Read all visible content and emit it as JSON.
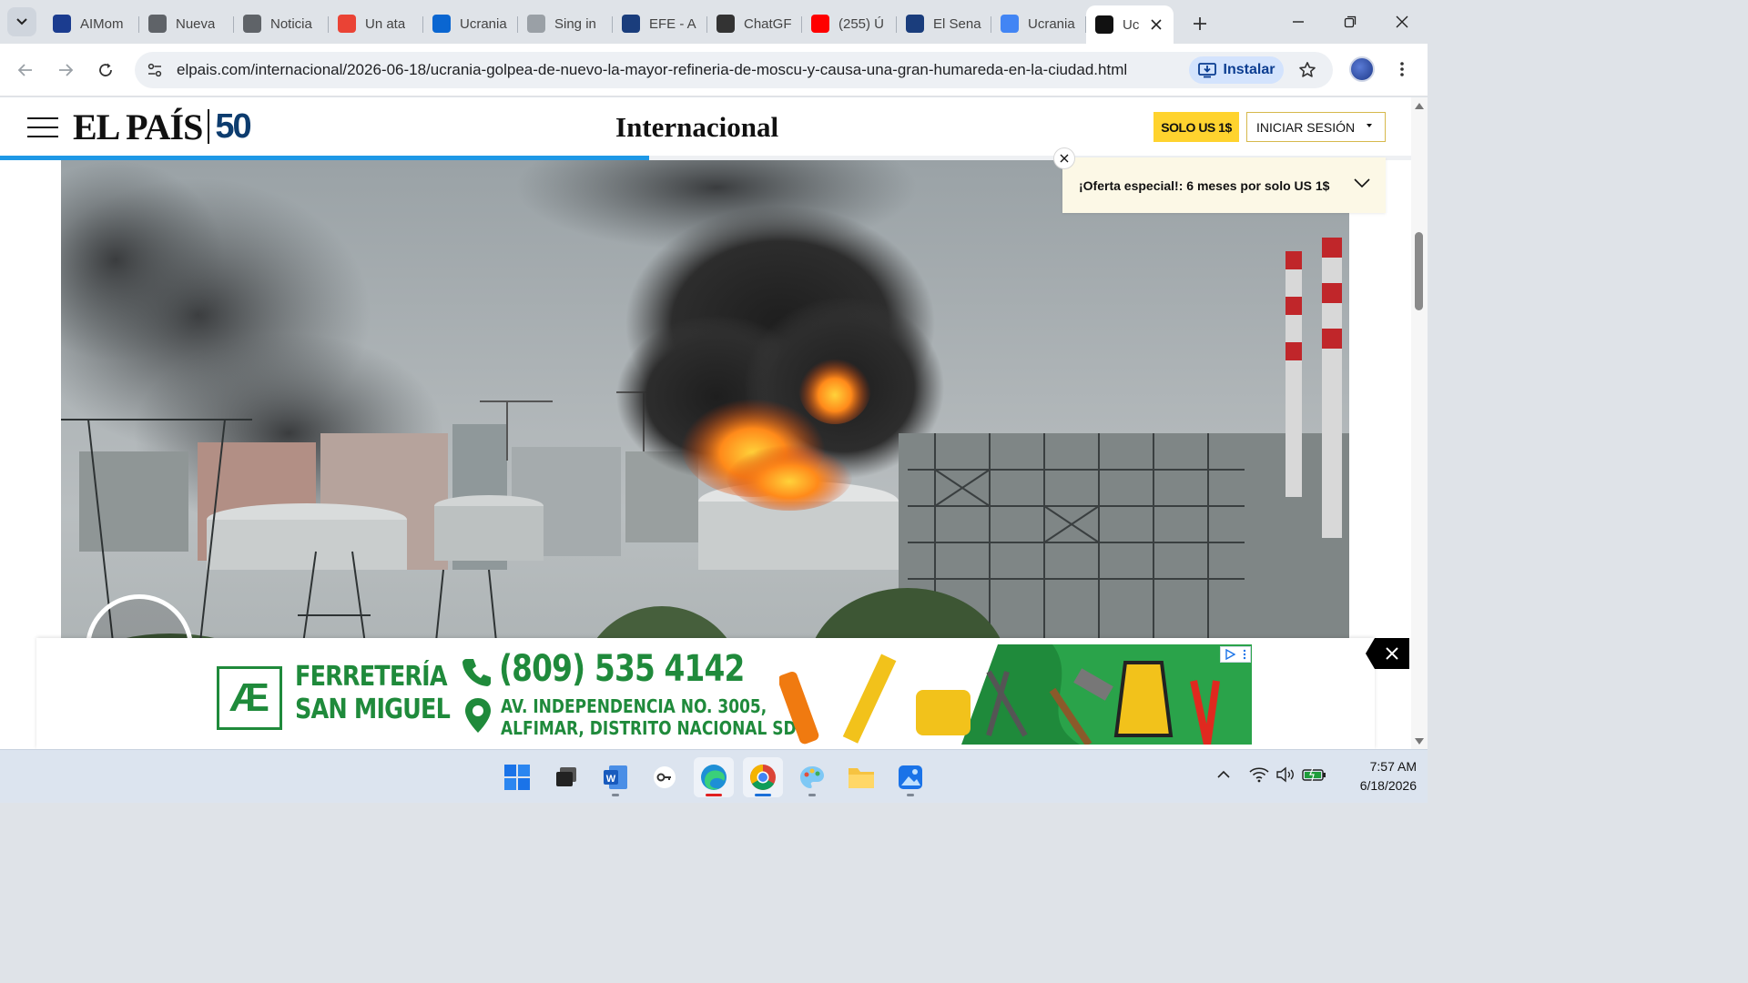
{
  "browser": {
    "tabs": [
      {
        "label": "AIMom",
        "fav_color": "#1b3c8f",
        "icon": "aimom-favicon"
      },
      {
        "label": "Nueva",
        "fav_color": "#5f6368",
        "icon": "globe-icon"
      },
      {
        "label": "Noticia",
        "fav_color": "#5f6368",
        "icon": "globe-icon"
      },
      {
        "label": "Un ata",
        "fav_color": "#ea4335",
        "icon": "gmail-icon"
      },
      {
        "label": "Ucrania",
        "fav_color": "#0a66d1",
        "icon": "news-favicon"
      },
      {
        "label": "Sing in",
        "fav_color": "#9aa0a6",
        "icon": "signin-favicon"
      },
      {
        "label": "EFE - A",
        "fav_color": "#1a3d7c",
        "icon": "efe-favicon"
      },
      {
        "label": "ChatGF",
        "fav_color": "#333333",
        "icon": "chatgpt-icon"
      },
      {
        "label": "(255) Ú",
        "fav_color": "#ff0000",
        "icon": "youtube-icon"
      },
      {
        "label": "El Sena",
        "fav_color": "#1a3d7c",
        "icon": "efe-favicon"
      },
      {
        "label": "Ucrania",
        "fav_color": "#4285f4",
        "icon": "google-icon"
      },
      {
        "label": "Uc",
        "fav_color": "#111111",
        "icon": "elpais-favicon",
        "active": true
      }
    ],
    "url": "elpais.com/internacional/2026-06-18/ucrania-golpea-de-nuevo-la-mayor-refineria-de-moscu-y-causa-una-gran-humareda-en-la-ciudad.html",
    "install_label": "Instalar"
  },
  "site": {
    "logo_text": "EL PAÍS",
    "logo_badge": "50",
    "section": "Internacional",
    "subscribe_label": "SOLO US 1$",
    "login_label": "INICIAR SESIÓN",
    "reading_progress": 0.46,
    "offer_text": "¡Oferta especial!: 6 meses por solo US 1$"
  },
  "ad": {
    "logo_mark": "Æ",
    "brand_line1": "FERRETERÍA",
    "brand_line2": "SAN MIGUEL",
    "phone": "(809) 535 4142",
    "address_line1": "AV. INDEPENDENCIA NO. 3005,",
    "address_line2": "ALFIMAR, DISTRITO NACIONAL SD"
  },
  "taskbar": {
    "time": "7:57 AM",
    "date": "6/18/2026"
  },
  "colors": {
    "accent_blue": "#1e98e6",
    "subscribe_yellow": "#ffd32e",
    "ad_green": "#1f8a3b"
  }
}
